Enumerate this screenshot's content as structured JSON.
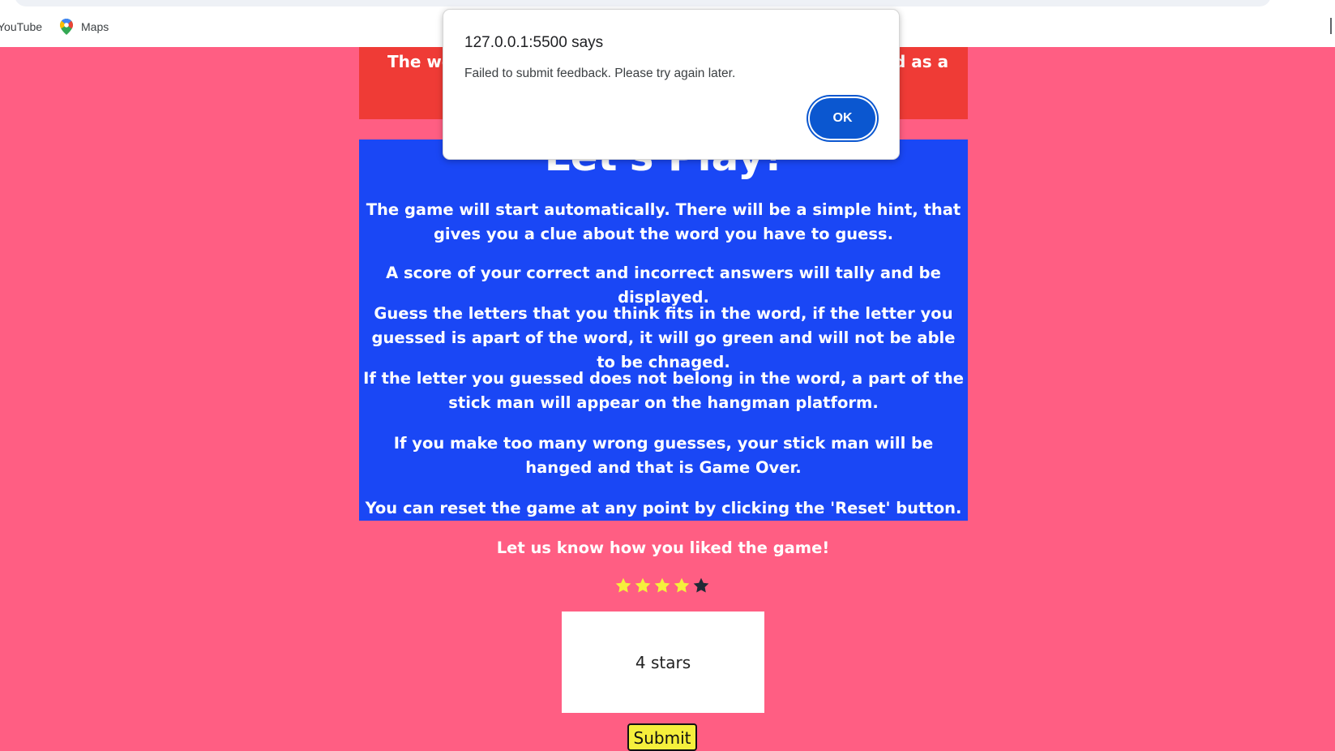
{
  "browser": {
    "bookmarks": [
      {
        "label": "YouTube"
      },
      {
        "label": "Maps",
        "icon": "maps-pin-icon"
      }
    ]
  },
  "background_cards": {
    "red_left_text": "The wo",
    "red_right_text": "d as a"
  },
  "instructions": {
    "title": "Let's Play!",
    "paragraphs": [
      "The game will start automatically. There will be a simple hint, that gives you a clue about the word you have to guess.",
      "A score of your correct and incorrect answers will tally and be displayed.",
      "Guess the letters that you think fits in the word, if the letter you guessed is apart of the word, it will go green and will not be able to be chnaged.",
      "If the letter you guessed does not belong in the word, a part of the stick man will appear on the hangman platform.",
      "If you make too many wrong guesses, your stick man will be hanged and that is Game Over.",
      "You can reset the game at any point by clicking the 'Reset' button."
    ]
  },
  "feedback": {
    "prompt": "Let us know how you liked the game!",
    "rating": 4,
    "max_rating": 5,
    "rating_text": "4 stars",
    "submit_label": "Submit"
  },
  "dialog": {
    "title": "127.0.0.1:5500 says",
    "message": "Failed to submit feedback. Please try again later.",
    "ok_label": "OK"
  },
  "colors": {
    "page_bg": "#ff5e83",
    "red_card": "#ef3b36",
    "blue_panel": "#1a47f5",
    "star_filled": "#f5ef3c",
    "star_empty": "#1f2a36",
    "submit_bg": "#f5ef3c",
    "ok_button": "#0b57d0"
  }
}
